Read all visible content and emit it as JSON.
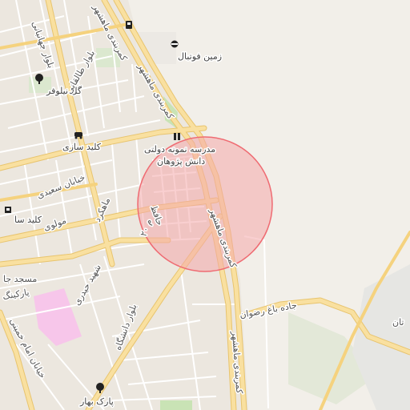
{
  "map": {
    "labels": {
      "zamin_football": "زمین فوتبال",
      "gol_niloufar": "گل نیلوفر",
      "kelid_sazi_1": "کلید سازی",
      "kelid_sazi_2": "کلید سا",
      "madrese_line1": "مدرسه نمونه دولتی",
      "madrese_line2": "دانش پژوهان",
      "khiaban_saeedi": "خیابان سعیدی",
      "molavi": "مولوی",
      "masjed": "مسجد جا",
      "parking": "پارکینگ",
      "park_bahar": "پارک بهار",
      "bolvar_jahanbani": "بلوار جهانبانی",
      "bolvar_taleghani": "بلوار طالقانی",
      "mahkerd": "ماهکرد",
      "hafez": "حافظ",
      "mahshahr_1": "کمربندی ماهشهر",
      "mahshahr_2": "کمربندی ماهشهر",
      "mahshahr_3": "کمربندی ماهشهر",
      "mahshahr_4": "کمربندی ماهشهر",
      "mahshahr_5": "کمربندی ماهشهر",
      "shahid_heydari": "شهید حیدری",
      "bolvar_daneshgah": "بلوار دانشگاه",
      "jadde_bagh_rezvan": "جاده باغ رضوان",
      "khiaban_emam_khomeini": "خیابان امام خمینی",
      "tan": "تان",
      "m20": "م ۲۰"
    },
    "icons": [
      "fuel-icon",
      "stadium-icon",
      "tree-icon",
      "car-icon",
      "school-icon",
      "shop-icon"
    ],
    "colors": {
      "background": "#f2efe9",
      "road_major": "#f7d98f",
      "road_major_casing": "#e8c46e",
      "road_minor": "#ffffff",
      "park": "#c9e3b5",
      "highlight_fill": "#f4a8aa",
      "highlight_stroke": "#ef6b72",
      "hospital": "#f7c6ea"
    }
  }
}
